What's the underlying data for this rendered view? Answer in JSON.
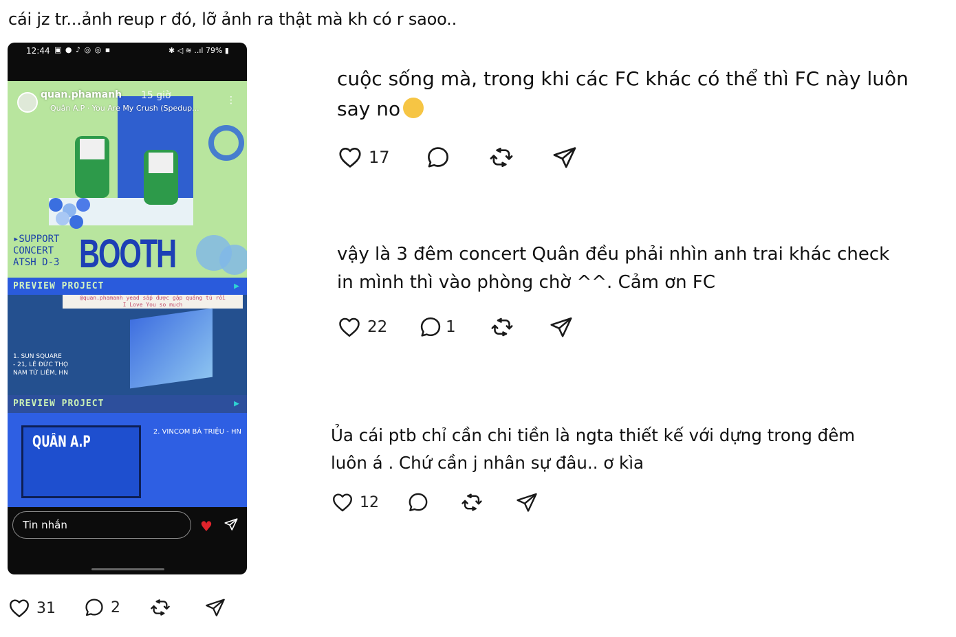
{
  "post": {
    "top_fragment": "",
    "caption": "cái jz tr...ảnh reup r đó, lỡ ảnh ra thật mà kh có r saoo..",
    "likes": "31",
    "comments": "2"
  },
  "phone": {
    "status_time": "12:44",
    "status_battery": "79%",
    "story_user": "quan.phamanh",
    "story_time": "15 giờ",
    "story_song": "Quân A.P · You Are My Crush (Spedup...",
    "support_lines": [
      "▸SUPPORT",
      "CONCERT",
      "ATSH D-3"
    ],
    "booth_word": "BOOTH",
    "preview1": "PREVIEW PROJECT",
    "preview2": "PREVIEW PROJECT",
    "note_line1": "@quan.phamanh yead sắp được gặp quảng tú rồi",
    "note_line2": "I Love You so much",
    "loc1_line1": "1. SUN SQUARE",
    "loc1_line2": "- 21, LÊ ĐỨC THỌ",
    "loc1_line3": "NAM TỪ LIÊM, HN",
    "loc2": "2. VINCOM BÀ TRIỆU - HN",
    "billboard_name": "QUÂN A.P",
    "message_placeholder": "Tin nhắn"
  },
  "replies": [
    {
      "text_line1": "cuộc sống mà, trong khi các FC khác có thể thì FC này luôn",
      "text_line2": "say no",
      "likes": "17",
      "comments": ""
    },
    {
      "text_line1": "vậy là 3 đêm concert Quân đều phải nhìn anh trai khác check",
      "text_line2": "in mình thì vào phòng chờ ^^. Cảm ơn FC",
      "likes": "22",
      "comments": "1"
    },
    {
      "text_line1": "Ủa cái ptb chỉ cần chi tiền là ngta thiết kế với dựng trong đêm",
      "text_line2": "luôn á . Chứ cần j nhân sự đâu.. ơ kìa",
      "likes": "12",
      "comments": ""
    }
  ],
  "icons": {
    "like": "heart-outline-icon",
    "comment": "speech-bubble-icon",
    "repost": "repost-icon",
    "share": "send-icon",
    "emoji": "smiling-face-with-tear-emoji"
  },
  "colors": {
    "story_green": "#b8e59e",
    "booth_blue": "#1d3fb5",
    "billboard_blue": "#2e5fe3",
    "heart_red": "#e0242c"
  }
}
